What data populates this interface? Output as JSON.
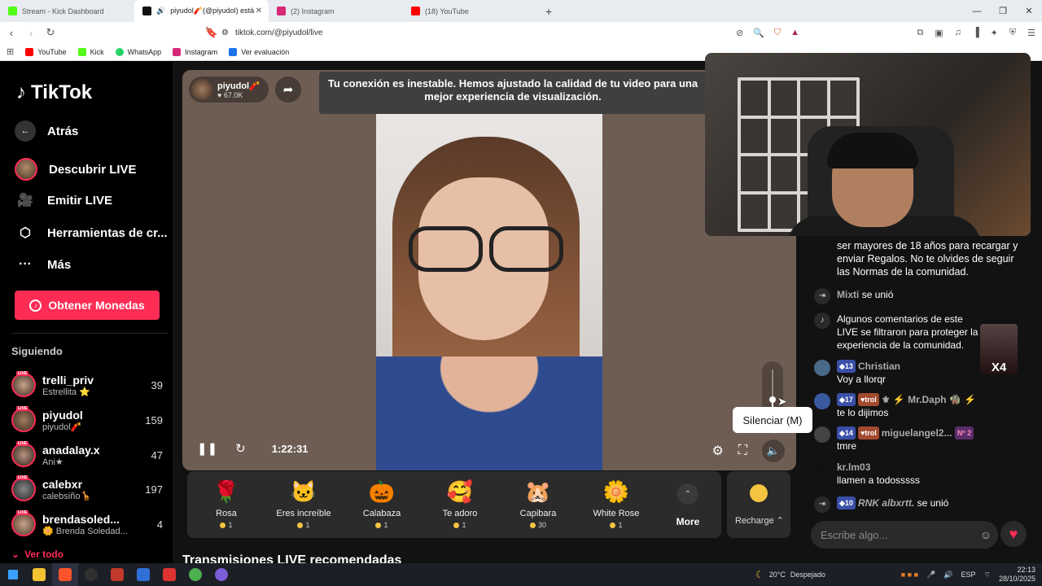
{
  "browser": {
    "tabs": [
      {
        "label": "Stream - Kick Dashboard",
        "color": "#53fc18",
        "active": false
      },
      {
        "label": "piyudol🧨(@piyudol) está LIVE",
        "color": "#111111",
        "active": true
      },
      {
        "label": "(2) Instagram",
        "color": "#d62976",
        "active": false
      },
      {
        "label": "(18) YouTube",
        "color": "#ff0000",
        "active": false
      }
    ],
    "url": "tiktok.com/@piyudol/live",
    "bookmarks": [
      {
        "label": "YouTube",
        "color": "#ff0000"
      },
      {
        "label": "Kick",
        "color": "#53fc18"
      },
      {
        "label": "WhatsApp",
        "color": "#25d366"
      },
      {
        "label": "Instagram",
        "color": "#d62976"
      },
      {
        "label": "Ver evaluación",
        "color": "#1a73e8"
      }
    ]
  },
  "sidebar": {
    "logo": "TikTok",
    "back": "Atrás",
    "nav": [
      {
        "label": "Descubrir LIVE",
        "icon": "avatar"
      },
      {
        "label": "Emitir LIVE",
        "icon": "camera-icon"
      },
      {
        "label": "Herramientas de cr...",
        "icon": "creator-tools-icon"
      },
      {
        "label": "Más",
        "icon": "more-icon"
      }
    ],
    "coins_button": "Obtener Monedas",
    "following_title": "Siguiendo",
    "following": [
      {
        "name": "trelli_priv",
        "sub": "Estrellita ⭐",
        "count": "39"
      },
      {
        "name": "piyudol",
        "sub": "piyudol🧨",
        "count": "159"
      },
      {
        "name": "anadalay.x",
        "sub": "Ani★",
        "count": "47"
      },
      {
        "name": "calebxr",
        "sub": "calebsiño🦒",
        "count": "197"
      },
      {
        "name": "brendasoled...",
        "sub": "🌼 Brenda Soledad...",
        "count": "4"
      }
    ],
    "see_all": "Ver todo"
  },
  "player": {
    "creator_name": "piyudol🧨",
    "creator_likes": "♥ 67.0K",
    "banner": "Tu conexión es inestable. Hemos ajustado la calidad de tu video para una mejor experiencia de visualización.",
    "time": "1:22:31",
    "volume_level": 0.45,
    "tooltip": "Silenciar (M)"
  },
  "gifts": [
    {
      "name": "Rosa",
      "price": "1",
      "emoji": "🌹"
    },
    {
      "name": "Eres increíble",
      "price": "1",
      "emoji": "🐱"
    },
    {
      "name": "Calabaza",
      "price": "1",
      "emoji": "🎃"
    },
    {
      "name": "Te adoro",
      "price": "1",
      "emoji": "🥰"
    },
    {
      "name": "Capibara",
      "price": "30",
      "emoji": "🐹"
    },
    {
      "name": "White Rose",
      "price": "1",
      "emoji": "🌼"
    }
  ],
  "gifts_more": "More",
  "recharge": "Recharge",
  "recommended_title": "Transmisiones LIVE recomendadas",
  "chat": {
    "messages": [
      {
        "type": "system",
        "text": "ser mayores de 18 años para recargar y enviar Regalos. No te olvides de seguir las Normas de la comunidad."
      },
      {
        "type": "join",
        "name": "Mixti",
        "text": "se unió"
      },
      {
        "type": "system2",
        "text": "Algunos comentarios de este LIVE se filtraron para proteger la experiencia de la comunidad."
      },
      {
        "type": "user",
        "level": "13",
        "name": "Christian",
        "text": "Voy a llorqr"
      },
      {
        "type": "user",
        "level": "17",
        "trol": "trol",
        "name": "⚜ ⚡ Mr.Daph 🧌 ⚡",
        "text": "te lo dijimos"
      },
      {
        "type": "user",
        "level": "14",
        "trol": "trol",
        "name": "miguelangel2...",
        "extra": "Nº 2",
        "text": "tmre"
      },
      {
        "type": "user",
        "name": "kr.lm03",
        "text": "llamen a todosssss"
      },
      {
        "type": "join",
        "level": "10",
        "name": "RNK albxrtt.",
        "text": "se unió"
      }
    ],
    "input_placeholder": "Escribe algo...",
    "x4_label": "X4"
  },
  "taskbar": {
    "weather": "20°C",
    "weather_desc": "Despejado",
    "lang": "ESP",
    "time": "22:13",
    "date": "28/10/2025"
  }
}
